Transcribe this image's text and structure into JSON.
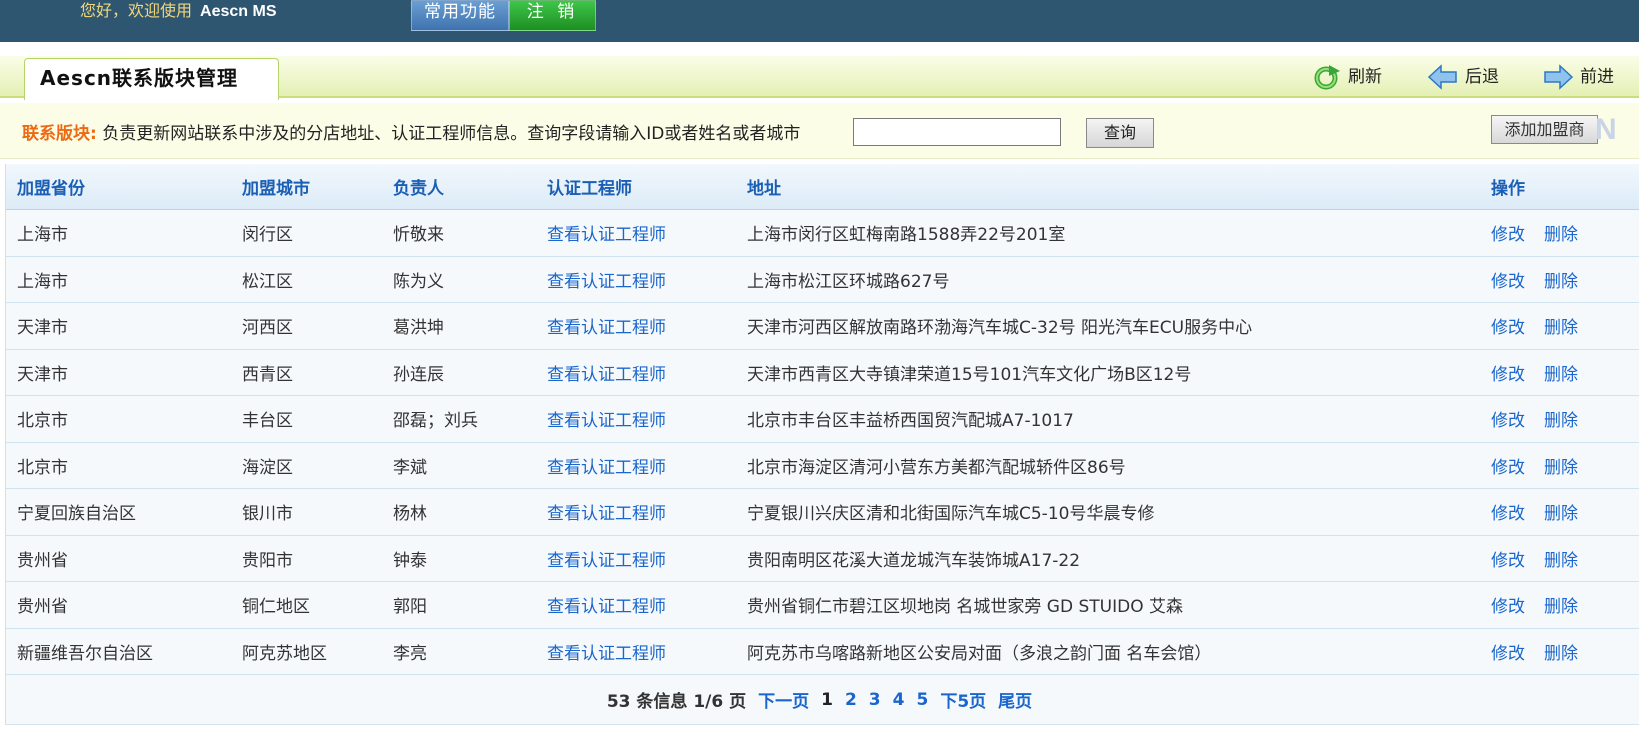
{
  "header": {
    "welcome": "您好，欢迎使用",
    "app_name": "Aescn MS",
    "common_functions": "常用功能",
    "logout": "注 销"
  },
  "title_bar": {
    "tab_title": "Aescn联系版块管理",
    "refresh": "刷新",
    "back": "后退",
    "forward": "前进"
  },
  "search": {
    "label": "联系版块:",
    "description": "负责更新网站联系中涉及的分店地址、认证工程师信息。查询字段请输入ID或者姓名或者城市",
    "input_value": "",
    "query_button": "查询",
    "add_button": "添加加盟商",
    "add_glyph": "N"
  },
  "table": {
    "columns": [
      "加盟省份",
      "加盟城市",
      "负责人",
      "认证工程师",
      "地址",
      "操作"
    ],
    "rows": [
      {
        "province": "上海市",
        "city": "闵行区",
        "manager": "忻敬来",
        "engineer": "查看认证工程师",
        "address": "上海市闵行区虹梅南路1588弄22号201室",
        "edit": "修改",
        "delete": "删除"
      },
      {
        "province": "上海市",
        "city": "松江区",
        "manager": "陈为义",
        "engineer": "查看认证工程师",
        "address": "上海市松江区环城路627号",
        "edit": "修改",
        "delete": "删除"
      },
      {
        "province": "天津市",
        "city": "河西区",
        "manager": "葛洪坤",
        "engineer": "查看认证工程师",
        "address": "天津市河西区解放南路环渤海汽车城C-32号 阳光汽车ECU服务中心",
        "edit": "修改",
        "delete": "删除"
      },
      {
        "province": "天津市",
        "city": "西青区",
        "manager": "孙连辰",
        "engineer": "查看认证工程师",
        "address": "天津市西青区大寺镇津荣道15号101汽车文化广场B区12号",
        "edit": "修改",
        "delete": "删除"
      },
      {
        "province": "北京市",
        "city": "丰台区",
        "manager": "邵磊；刘兵",
        "engineer": "查看认证工程师",
        "address": "北京市丰台区丰益桥西国贸汽配城A7-1017",
        "edit": "修改",
        "delete": "删除"
      },
      {
        "province": "北京市",
        "city": "海淀区",
        "manager": "李斌",
        "engineer": "查看认证工程师",
        "address": "北京市海淀区清河小营东方美都汽配城轿件区86号",
        "edit": "修改",
        "delete": "删除"
      },
      {
        "province": "宁夏回族自治区",
        "city": "银川市",
        "manager": "杨林",
        "engineer": "查看认证工程师",
        "address": "宁夏银川兴庆区清和北街国际汽车城C5-10号华晨专修",
        "edit": "修改",
        "delete": "删除"
      },
      {
        "province": "贵州省",
        "city": "贵阳市",
        "manager": "钟泰",
        "engineer": "查看认证工程师",
        "address": "贵阳南明区花溪大道龙城汽车装饰城A17-22",
        "edit": "修改",
        "delete": "删除"
      },
      {
        "province": "贵州省",
        "city": "铜仁地区",
        "manager": "郭阳",
        "engineer": "查看认证工程师",
        "address": "贵州省铜仁市碧江区坝地岗 名城世家旁 GD STUIDO 艾森",
        "edit": "修改",
        "delete": "删除"
      },
      {
        "province": "新疆维吾尔自治区",
        "city": "阿克苏地区",
        "manager": "李亮",
        "engineer": "查看认证工程师",
        "address": "阿克苏市乌喀路新地区公安局对面（多浪之韵门面 名车会馆）",
        "edit": "修改",
        "delete": "删除"
      }
    ]
  },
  "pagination": {
    "info": "53 条信息 1/6 页",
    "next": "下一页",
    "pages": [
      "1",
      "2",
      "3",
      "4",
      "5"
    ],
    "current": "1",
    "next5": "下5页",
    "last": "尾页"
  },
  "colors": {
    "topbar": "#2f5670",
    "accent_link": "#1a66cc",
    "label_orange": "#ee6a10"
  }
}
